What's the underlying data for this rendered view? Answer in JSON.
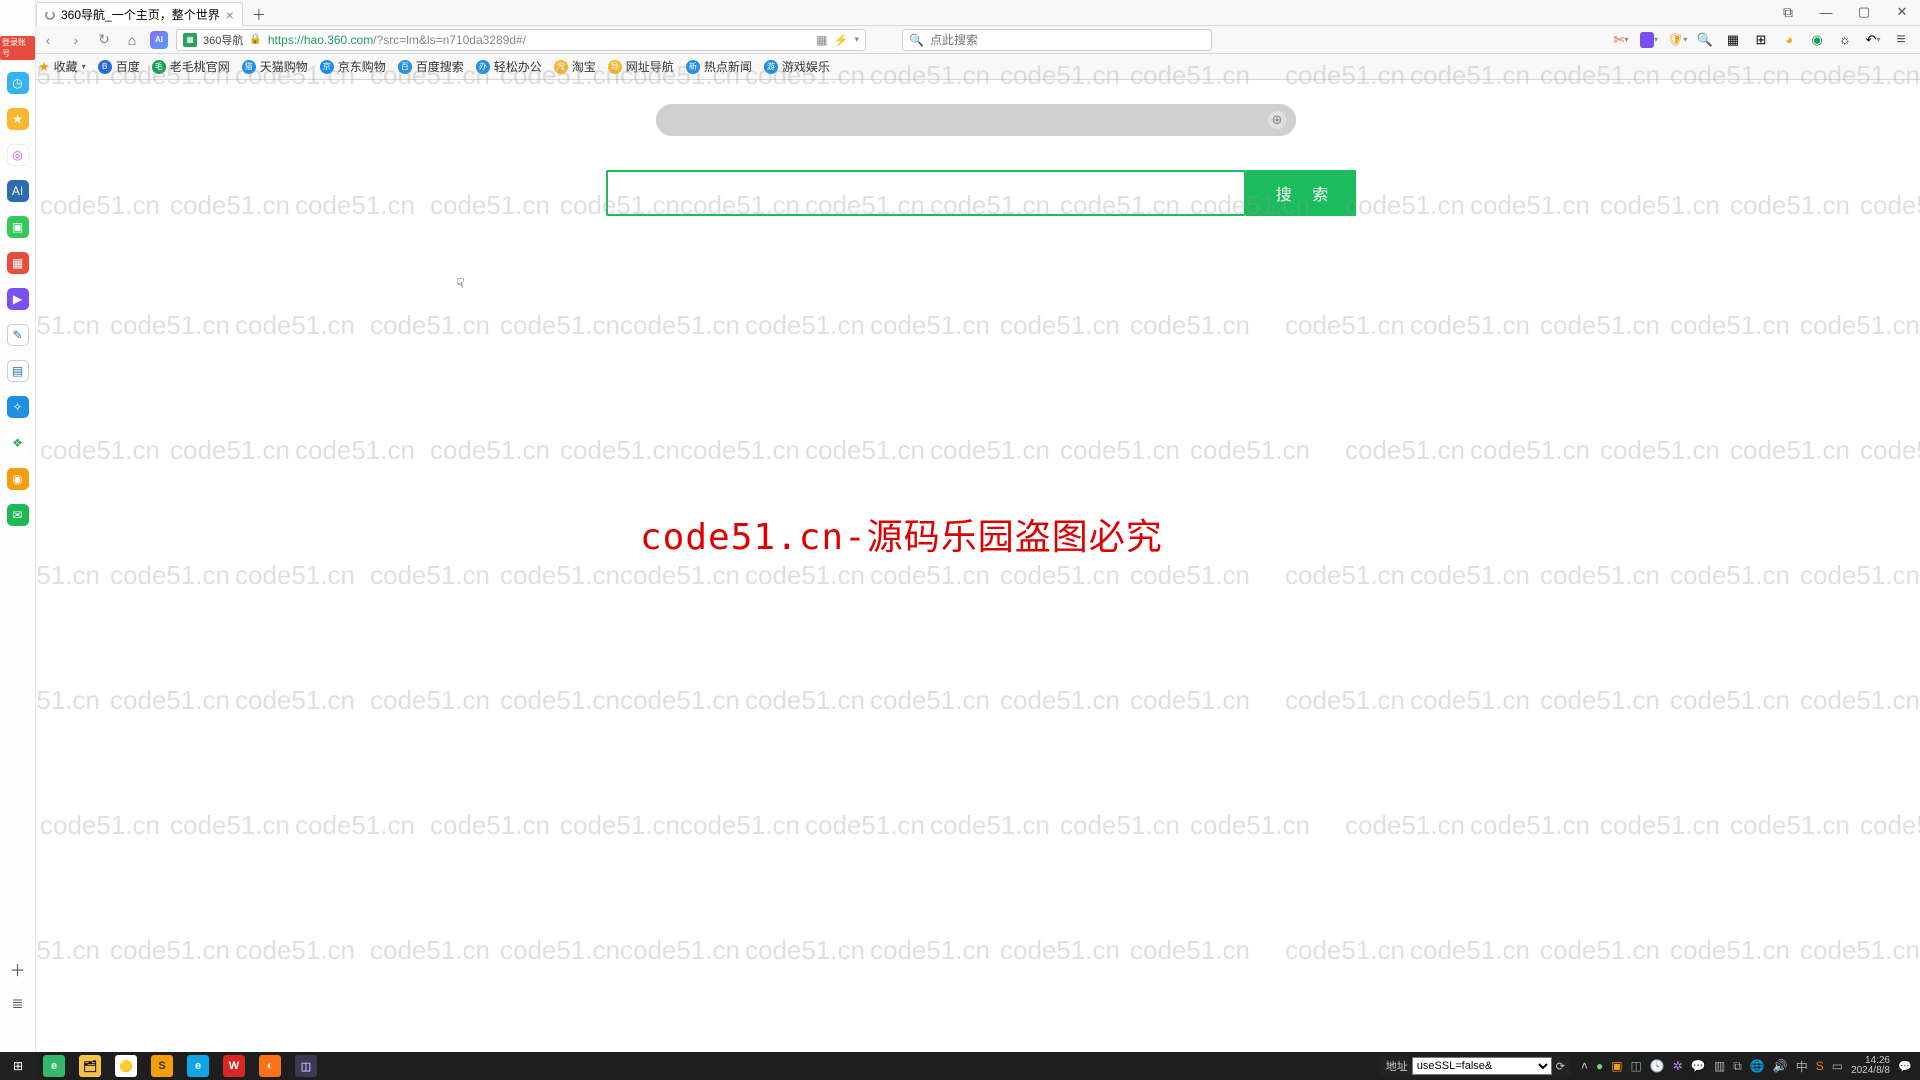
{
  "watermark_text": "code51.cn",
  "watermark_red": "code51.cn-源码乐园盗图必究",
  "tab": {
    "title": "360导航_一个主页，整个世界"
  },
  "address": {
    "site_label": "360导航",
    "protocol": "https://",
    "host": "hao.360.com",
    "path": "/?src=lm&ls=n710da3289d#/"
  },
  "omnibox_search_placeholder": "点此搜索",
  "bookmarks": {
    "fav_label": "收藏",
    "items": [
      {
        "label": "百度"
      },
      {
        "label": "老毛桃官网"
      },
      {
        "label": "天猫购物"
      },
      {
        "label": "京东购物"
      },
      {
        "label": "百度搜索"
      },
      {
        "label": "轻松办公"
      },
      {
        "label": "淘宝"
      },
      {
        "label": "网址导航"
      },
      {
        "label": "热点新闻"
      },
      {
        "label": "游戏娱乐"
      }
    ]
  },
  "left_strip_badge": "登录账号",
  "page_search_button": "搜 索",
  "taskbar": {
    "addr_label": "地址",
    "select_value": "useSSL=false&",
    "time": "14:26",
    "date": "2024/8/8"
  }
}
